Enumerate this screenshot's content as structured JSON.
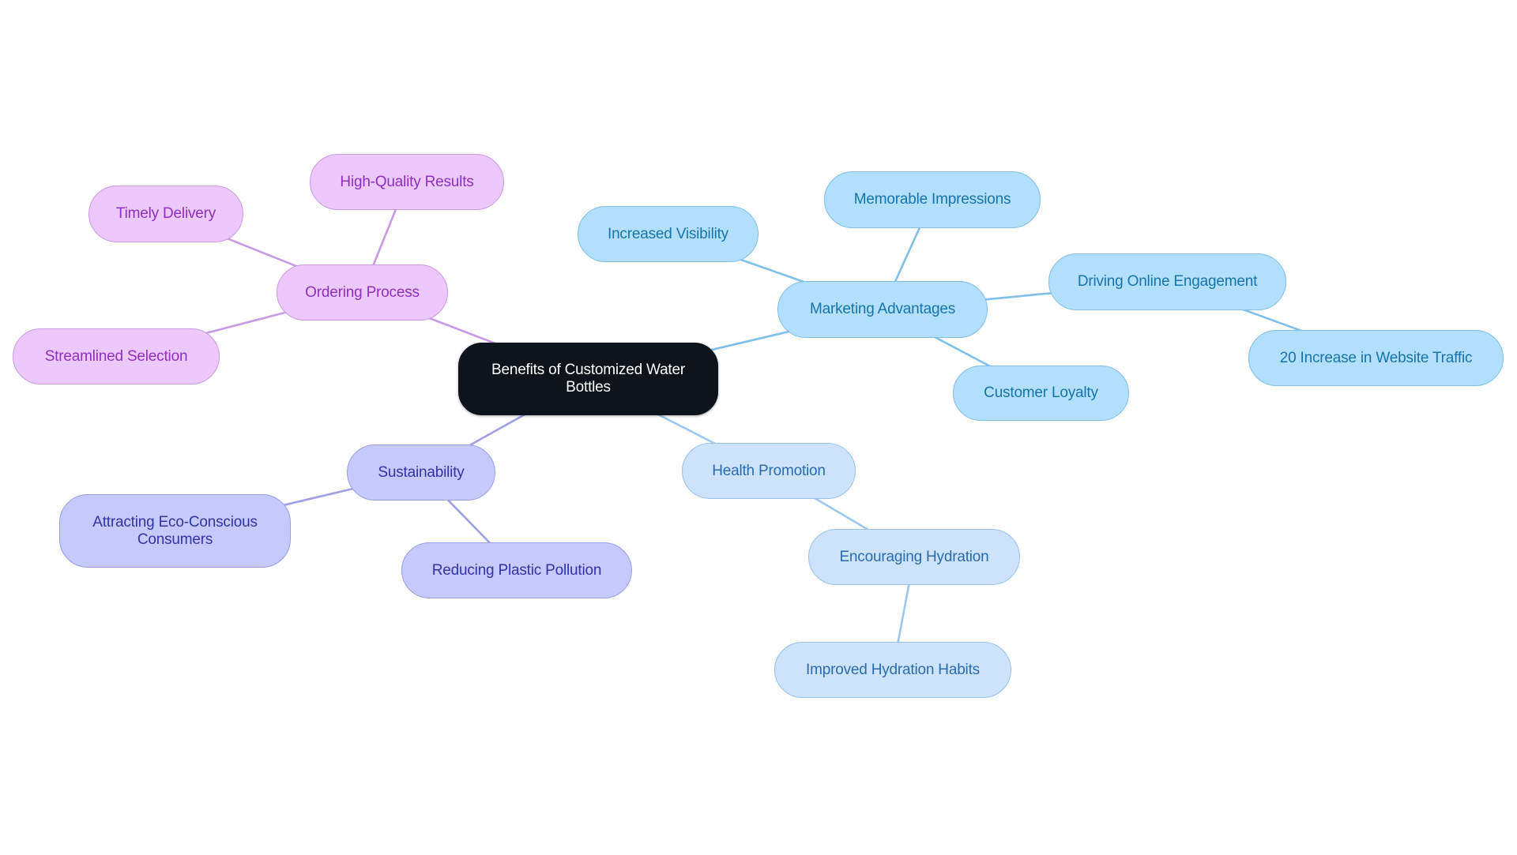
{
  "diagram": {
    "type": "mindmap",
    "root": {
      "id": "center",
      "label": "Benefits of Customized Water Bottles",
      "label_lines": [
        "Benefits of Customized Water",
        "Bottles"
      ]
    },
    "branches": [
      {
        "id": "ordering",
        "label": "Ordering Process",
        "theme": "purple",
        "children": [
          {
            "id": "hq",
            "label": "High-Quality Results"
          },
          {
            "id": "timely",
            "label": "Timely Delivery"
          },
          {
            "id": "streamlined",
            "label": "Streamlined Selection"
          }
        ]
      },
      {
        "id": "marketing",
        "label": "Marketing Advantages",
        "theme": "sky",
        "children": [
          {
            "id": "visibility",
            "label": "Increased Visibility"
          },
          {
            "id": "memorable",
            "label": "Memorable Impressions"
          },
          {
            "id": "driving",
            "label": "Driving Online Engagement",
            "children": [
              {
                "id": "traffic",
                "label": "20 Increase in Website Traffic"
              }
            ]
          },
          {
            "id": "loyalty",
            "label": "Customer Loyalty"
          }
        ]
      },
      {
        "id": "health",
        "label": "Health Promotion",
        "theme": "lightblue",
        "children": [
          {
            "id": "hydration",
            "label": "Encouraging Hydration",
            "children": [
              {
                "id": "habits",
                "label": "Improved Hydration Habits"
              }
            ]
          }
        ]
      },
      {
        "id": "sustain",
        "label": "Sustainability",
        "theme": "indigo",
        "children": [
          {
            "id": "eco",
            "label": "Attracting Eco-Conscious Consumers",
            "label_lines": [
              "Attracting Eco-Conscious",
              "Consumers"
            ]
          },
          {
            "id": "plastic",
            "label": "Reducing Plastic Pollution"
          }
        ]
      }
    ],
    "nodes": {
      "center": {
        "label": "Benefits of Customized Water Bottles"
      },
      "ordering": {
        "label": "Ordering Process"
      },
      "hq": {
        "label": "High-Quality Results"
      },
      "timely": {
        "label": "Timely Delivery"
      },
      "streamlined": {
        "label": "Streamlined Selection"
      },
      "marketing": {
        "label": "Marketing Advantages"
      },
      "visibility": {
        "label": "Increased Visibility"
      },
      "memorable": {
        "label": "Memorable Impressions"
      },
      "driving": {
        "label": "Driving Online Engagement"
      },
      "traffic": {
        "label": "20 Increase in Website Traffic"
      },
      "loyalty": {
        "label": "Customer Loyalty"
      },
      "health": {
        "label": "Health Promotion"
      },
      "hydration": {
        "label": "Encouraging Hydration"
      },
      "habits": {
        "label": "Improved Hydration Habits"
      },
      "sustain": {
        "label": "Sustainability"
      },
      "eco": {
        "label": "Attracting Eco-Conscious Consumers"
      },
      "plastic": {
        "label": "Reducing Plastic Pollution"
      }
    },
    "edges": [
      [
        "center",
        "ordering"
      ],
      [
        "ordering",
        "hq"
      ],
      [
        "ordering",
        "timely"
      ],
      [
        "ordering",
        "streamlined"
      ],
      [
        "center",
        "marketing"
      ],
      [
        "marketing",
        "visibility"
      ],
      [
        "marketing",
        "memorable"
      ],
      [
        "marketing",
        "driving"
      ],
      [
        "driving",
        "traffic"
      ],
      [
        "marketing",
        "loyalty"
      ],
      [
        "center",
        "health"
      ],
      [
        "health",
        "hydration"
      ],
      [
        "hydration",
        "habits"
      ],
      [
        "center",
        "sustain"
      ],
      [
        "sustain",
        "eco"
      ],
      [
        "sustain",
        "plastic"
      ]
    ],
    "themes": {
      "root": {
        "fill": "#0d141c",
        "stroke": "#0d141c",
        "text": "#ffffff",
        "edge": "#7fb8e6"
      },
      "purple": {
        "fill": "#ecc8fc",
        "stroke": "#c99ae6",
        "text": "#8f2fc0",
        "edge": "#c79ae4"
      },
      "sky": {
        "fill": "#b2dffb",
        "stroke": "#7fbfe8",
        "text": "#1674ad",
        "edge": "#7fbfe8"
      },
      "lightblue": {
        "fill": "#cce3fb",
        "stroke": "#96c2ec",
        "text": "#2a6bb0",
        "edge": "#9dc6ee"
      },
      "indigo": {
        "fill": "#c6c9fb",
        "stroke": "#9a9de6",
        "text": "#3034a8",
        "edge": "#9ea0e3"
      }
    }
  }
}
